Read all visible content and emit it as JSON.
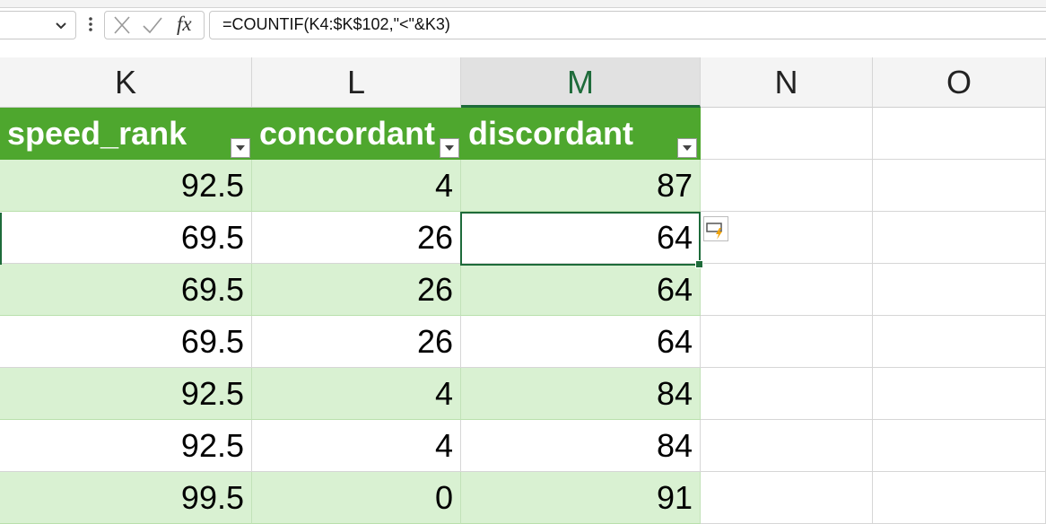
{
  "formula_bar": {
    "formula": "=COUNTIF(K4:$K$102,\"<\"&K3)",
    "fx_label": "fx"
  },
  "columns": [
    {
      "letter": "K",
      "selected": false
    },
    {
      "letter": "L",
      "selected": false
    },
    {
      "letter": "M",
      "selected": true
    },
    {
      "letter": "N",
      "selected": false
    },
    {
      "letter": "O",
      "selected": false
    }
  ],
  "table": {
    "headers": [
      "speed_rank",
      "concordant",
      "discordant"
    ],
    "rows": [
      [
        "92.5",
        "4",
        "87"
      ],
      [
        "69.5",
        "26",
        "64"
      ],
      [
        "69.5",
        "26",
        "64"
      ],
      [
        "69.5",
        "26",
        "64"
      ],
      [
        "92.5",
        "4",
        "84"
      ],
      [
        "92.5",
        "4",
        "84"
      ],
      [
        "99.5",
        "0",
        "91"
      ]
    ]
  },
  "colors": {
    "header_green": "#4ea72e",
    "band_green": "#d9f1d2",
    "selection_green": "#1e6b3a"
  }
}
